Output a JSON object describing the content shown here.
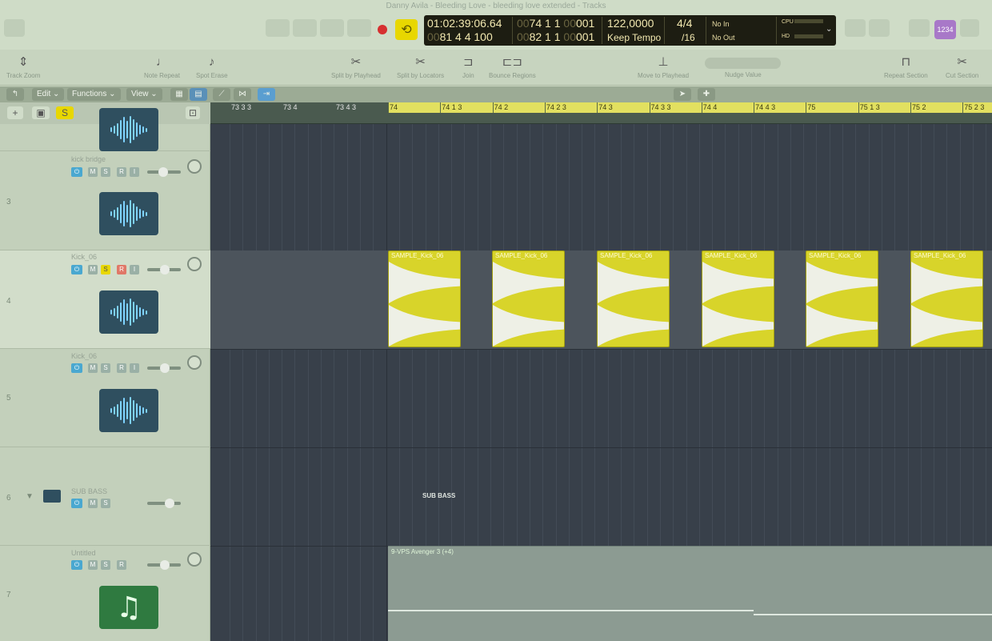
{
  "window": {
    "title": "Danny Avila - Bleeding Love - bleeding love extended - Tracks"
  },
  "lcd": {
    "time": "01:02:39:06.64",
    "time_sub": "81 4 4 100",
    "bars": "74 1 1",
    "bars_dim": "00",
    "bars_tick": "001",
    "bars_sub": "82 1 1",
    "bars_sub_dim": "00",
    "bars_sub_tick": "001",
    "tempo": "122,0000",
    "tempo_mode": "Keep Tempo",
    "sig": "4/4",
    "division": "/16",
    "in": "No In",
    "out": "No Out",
    "cpu_label": "CPU",
    "hd_label": "HD"
  },
  "badge": "1234",
  "toolbar": {
    "track_zoom": "Track Zoom",
    "note_repeat": "Note Repeat",
    "spot_erase": "Spot Erase",
    "split_playhead": "Split by Playhead",
    "split_locators": "Split by Locators",
    "join": "Join",
    "bounce": "Bounce Regions",
    "move_playhead": "Move to Playhead",
    "nudge": "Nudge Value",
    "repeat_section": "Repeat Section",
    "cut_section": "Cut Section"
  },
  "menu": {
    "edit": "Edit",
    "functions": "Functions",
    "view": "View"
  },
  "ruler": {
    "before": [
      "73 3 3",
      "73 4",
      "73 4 3"
    ],
    "after": [
      "74",
      "74 1 3",
      "74 2",
      "74 2 3",
      "74 3",
      "74 3 3",
      "74 4",
      "74 4 3",
      "75",
      "75 1 3",
      "75 2",
      "75 2 3"
    ]
  },
  "tracks": [
    {
      "number": "3",
      "name": "kick bridge"
    },
    {
      "number": "4",
      "name": "Kick_06"
    },
    {
      "number": "5",
      "name": "Kick_06"
    },
    {
      "number": "6",
      "name": "SUB BASS"
    },
    {
      "number": "7",
      "name": "Untitled"
    }
  ],
  "buttons": {
    "m": "M",
    "s": "S",
    "r": "R",
    "i": "I"
  },
  "regions": {
    "sample_name": "SAMPLE_Kick_06",
    "sub_bass_label": "SUB BASS",
    "midi_name": "9-VPS Avenger 3 (+4)"
  },
  "colors": {
    "accent_yellow": "#e8d700",
    "region_yellow": "#d8d42a",
    "record_red": "#d63030",
    "power_blue": "#4aa8d0"
  }
}
